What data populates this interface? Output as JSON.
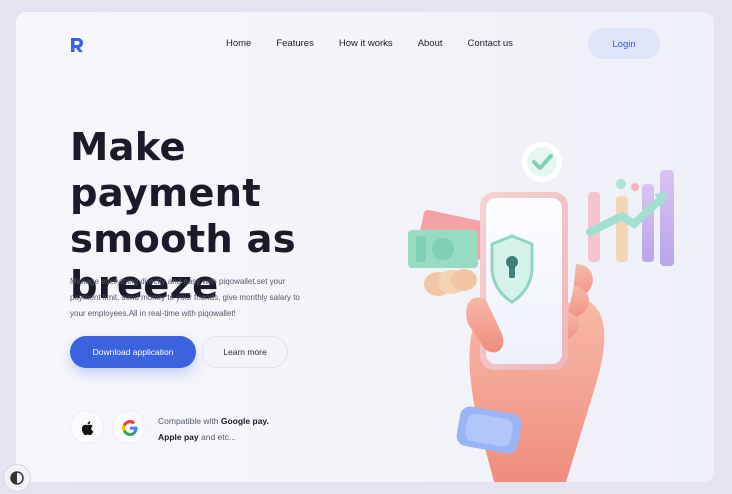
{
  "brand": {
    "name": ""
  },
  "nav": {
    "items": [
      "Home",
      "Features",
      "How it works",
      "About",
      "Contact us"
    ],
    "login_label": "Login"
  },
  "hero": {
    "headline_lines": [
      "Make payment",
      "smooth as",
      "breeze"
    ],
    "description_lines": [
      "Manage everything directly and easy with piqowallet.set your",
      "payment limit, send money to your friends, give monthly salary to",
      "your employees.All in real-time with piqowallet!"
    ],
    "primary_button": "Download application",
    "secondary_button": "Learn more"
  },
  "compatibility": {
    "prefix": "Compatible with",
    "app1": "Google pay.",
    "app2": "Apple pay",
    "suffix": "and etc..."
  },
  "icons": {
    "logo": "logo-icon",
    "apple": "apple-icon",
    "google": "google-icon",
    "theme_toggle": "theme-toggle-icon"
  },
  "colors": {
    "accent": "#3b63e0",
    "login_bg": "#dfe5f8",
    "heading": "#1a1a2a"
  }
}
